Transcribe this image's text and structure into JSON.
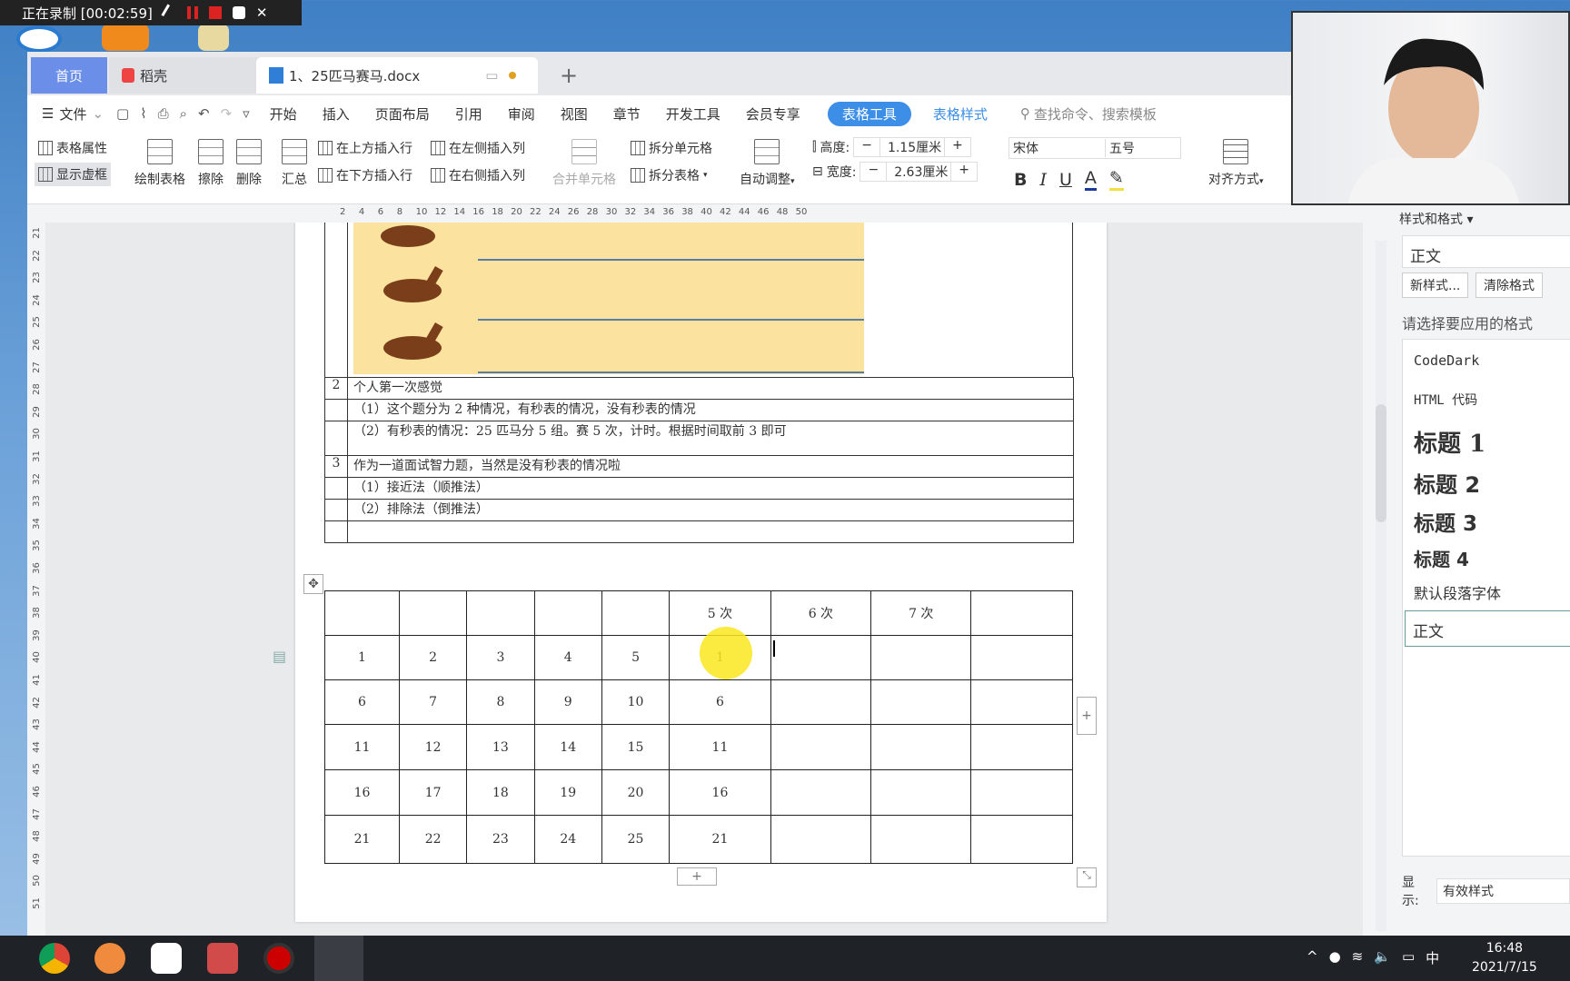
{
  "recording": {
    "label": "正在录制 [00:02:59]"
  },
  "tabs": [
    {
      "label": "首页"
    },
    {
      "label": "稻壳"
    },
    {
      "label": "1、25匹马赛马.docx"
    }
  ],
  "new_tab": "+",
  "menu": {
    "file": "文件",
    "items": [
      "开始",
      "插入",
      "页面布局",
      "引用",
      "审阅",
      "视图",
      "章节",
      "开发工具",
      "会员专享"
    ],
    "active": "表格工具",
    "table_style": "表格样式",
    "search_placeholder": "查找命令、搜索模板"
  },
  "ribbon": {
    "table_props": "表格属性",
    "show_grid": "显示虚框",
    "draw_table": "绘制表格",
    "erase": "擦除",
    "delete": "删除",
    "summary": "汇总",
    "insert_above": "在上方插入行",
    "insert_below": "在下方插入行",
    "insert_left": "在左侧插入列",
    "insert_right": "在右侧插入列",
    "merge_cells": "合并单元格",
    "split_cells": "拆分单元格",
    "split_table": "拆分表格",
    "auto_fit": "自动调整",
    "height_label": "高度:",
    "height_value": "1.15厘米",
    "width_label": "宽度:",
    "width_value": "2.63厘米",
    "font": "宋体",
    "font_size": "五号",
    "align": "对齐方式"
  },
  "ruler": [
    "2",
    "4",
    "6",
    "8",
    "10",
    "12",
    "14",
    "16",
    "18",
    "20",
    "22",
    "24",
    "26",
    "28",
    "30",
    "32",
    "34",
    "36",
    "38",
    "40",
    "42",
    "44",
    "46",
    "48",
    "50"
  ],
  "vruler": [
    "21",
    "22",
    "23",
    "24",
    "25",
    "26",
    "27",
    "28",
    "29",
    "30",
    "31",
    "32",
    "33",
    "34",
    "35",
    "36",
    "37",
    "38",
    "39",
    "40",
    "41",
    "42",
    "43",
    "44",
    "45",
    "46",
    "47",
    "48",
    "49",
    "50",
    "51"
  ],
  "doc": {
    "rows": [
      {
        "num": "2",
        "text": "个人第一次感觉"
      },
      {
        "num": "",
        "text": "（1）这个题分为 2 种情况，有秒表的情况，没有秒表的情况"
      },
      {
        "num": "",
        "text": "（2）有秒表的情况：25 匹马分 5 组。赛 5 次，计时。根据时间取前 3 即可"
      },
      {
        "num": "3",
        "text": "作为一道面试智力题，当然是没有秒表的情况啦"
      },
      {
        "num": "",
        "text": "（1）接近法（顺推法）"
      },
      {
        "num": "",
        "text": "（2）排除法（倒推法）"
      },
      {
        "num": "",
        "text": ""
      }
    ],
    "grid": [
      [
        "",
        "",
        "",
        "",
        "",
        "5 次",
        "6 次",
        "7 次",
        ""
      ],
      [
        "1",
        "2",
        "3",
        "4",
        "5",
        "1",
        "",
        "",
        ""
      ],
      [
        "6",
        "7",
        "8",
        "9",
        "10",
        "6",
        "",
        "",
        ""
      ],
      [
        "11",
        "12",
        "13",
        "14",
        "15",
        "11",
        "",
        "",
        ""
      ],
      [
        "16",
        "17",
        "18",
        "19",
        "20",
        "16",
        "",
        "",
        ""
      ],
      [
        "21",
        "22",
        "23",
        "24",
        "25",
        "21",
        "",
        "",
        ""
      ]
    ]
  },
  "side": {
    "title": "样式和格式",
    "current": "正文",
    "new_style": "新样式...",
    "clear": "清除格式",
    "prompt": "请选择要应用的格式",
    "styles": [
      "CodeDark",
      "HTML 代码",
      "标题 1",
      "标题 2",
      "标题 3",
      "标题 4",
      "默认段落字体",
      "正文"
    ],
    "show_label": "显示:",
    "show_value": "有效样式"
  },
  "taskbar": {
    "time": "16:48",
    "date": "2021/7/15",
    "ime": "中"
  },
  "colors": {
    "accent": "#3d8ee6",
    "tab_home": "#6b8ee8",
    "horse_bg": "#fbe29e"
  }
}
